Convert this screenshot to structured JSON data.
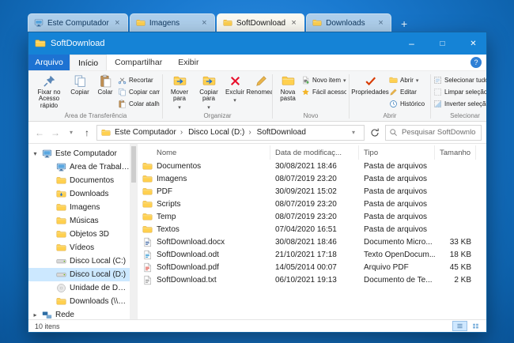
{
  "colors": {
    "accent": "#1583d6",
    "selection": "#cce8ff",
    "desktop": "#1371c8",
    "folder_yellow": "#ffd04f",
    "delete_red": "#e8112d"
  },
  "tabs": {
    "items": [
      {
        "label": "Este Computador",
        "icon": "this-pc"
      },
      {
        "label": "Imagens",
        "icon": "folder"
      },
      {
        "label": "SoftDownload",
        "icon": "folder",
        "active": true
      },
      {
        "label": "Downloads",
        "icon": "folder"
      }
    ]
  },
  "window": {
    "title": "SoftDownload"
  },
  "ribbon": {
    "file_tab": "Arquivo",
    "tabs": [
      {
        "label": "Início",
        "active": true
      },
      {
        "label": "Compartilhar"
      },
      {
        "label": "Exibir"
      }
    ],
    "clipboard": {
      "label": "Área de Transferência",
      "pin": "Fixar no Acesso rápido",
      "copy": "Copiar",
      "paste": "Colar",
      "cut": "Recortar",
      "copy_path": "Copiar caminho",
      "paste_shortcut": "Colar atalho"
    },
    "organize": {
      "label": "Organizar",
      "move_to": "Mover para",
      "copy_to": "Copiar para",
      "delete": "Excluir",
      "rename": "Renomear"
    },
    "new": {
      "label": "Novo",
      "new_folder": "Nova pasta",
      "new_item": "Novo item",
      "easy_access": "Fácil acesso"
    },
    "open": {
      "label": "Abrir",
      "properties": "Propriedades",
      "open": "Abrir",
      "edit": "Editar",
      "history": "Histórico"
    },
    "select": {
      "label": "Selecionar",
      "select_all": "Selecionar tudo",
      "clear": "Limpar seleção",
      "invert": "Inverter seleção"
    }
  },
  "address": {
    "breadcrumb": [
      {
        "label": "Este Computador"
      },
      {
        "label": "Disco Local (D:)"
      },
      {
        "label": "SoftDownload"
      }
    ],
    "search_placeholder": "Pesquisar SoftDownload"
  },
  "sidebar": {
    "items": [
      {
        "label": "Este Computador",
        "icon": "this-pc",
        "level": 0,
        "expander": "v"
      },
      {
        "label": "Área de Trabalho",
        "icon": "desktop",
        "level": 1
      },
      {
        "label": "Documentos",
        "icon": "documents",
        "level": 1
      },
      {
        "label": "Downloads",
        "icon": "downloads",
        "level": 1
      },
      {
        "label": "Imagens",
        "icon": "pictures",
        "level": 1
      },
      {
        "label": "Músicas",
        "icon": "music",
        "level": 1
      },
      {
        "label": "Objetos 3D",
        "icon": "objects-3d",
        "level": 1
      },
      {
        "label": "Vídeos",
        "icon": "videos",
        "level": 1
      },
      {
        "label": "Disco Local (C:)",
        "icon": "drive",
        "level": 1
      },
      {
        "label": "Disco Local (D:)",
        "icon": "drive",
        "level": 1,
        "selected": true
      },
      {
        "label": "Unidade de DVD (E:) D...",
        "icon": "dvd",
        "level": 1
      },
      {
        "label": "Downloads (\\\\192.168...",
        "icon": "network-folder",
        "level": 1
      },
      {
        "label": "Rede",
        "icon": "network",
        "level": 0,
        "expander": ">"
      }
    ]
  },
  "files": {
    "columns": [
      {
        "label": "Nome",
        "key": "name"
      },
      {
        "label": "Data de modificaç...",
        "key": "date"
      },
      {
        "label": "Tipo",
        "key": "type"
      },
      {
        "label": "Tamanho",
        "key": "size"
      }
    ],
    "rows": [
      {
        "name": "Documentos",
        "icon": "folder",
        "date": "30/08/2021 18:46",
        "type": "Pasta de arquivos",
        "size": ""
      },
      {
        "name": "Imagens",
        "icon": "folder",
        "date": "08/07/2019 23:20",
        "type": "Pasta de arquivos",
        "size": ""
      },
      {
        "name": "PDF",
        "icon": "folder",
        "date": "30/09/2021 15:02",
        "type": "Pasta de arquivos",
        "size": ""
      },
      {
        "name": "Scripts",
        "icon": "folder",
        "date": "08/07/2019 23:20",
        "type": "Pasta de arquivos",
        "size": ""
      },
      {
        "name": "Temp",
        "icon": "folder",
        "date": "08/07/2019 23:20",
        "type": "Pasta de arquivos",
        "size": ""
      },
      {
        "name": "Textos",
        "icon": "folder",
        "date": "07/04/2020 16:51",
        "type": "Pasta de arquivos",
        "size": ""
      },
      {
        "name": "SoftDownload.docx",
        "icon": "doc-word",
        "color": "#2a5699",
        "date": "30/08/2021 18:46",
        "type": "Documento Micro...",
        "size": "33 KB"
      },
      {
        "name": "SoftDownload.odt",
        "icon": "doc-odt",
        "color": "#0e85c8",
        "date": "21/10/2021 17:18",
        "type": "Texto OpenDocum...",
        "size": "18 KB"
      },
      {
        "name": "SoftDownload.pdf",
        "icon": "doc-pdf",
        "color": "#d93025",
        "date": "14/05/2014 00:07",
        "type": "Arquivo PDF",
        "size": "45 KB"
      },
      {
        "name": "SoftDownload.txt",
        "icon": "doc-txt",
        "color": "#8a8a8a",
        "date": "06/10/2021 19:13",
        "type": "Documento de Te...",
        "size": "2 KB"
      }
    ]
  },
  "status": {
    "items_count": "10 itens"
  }
}
